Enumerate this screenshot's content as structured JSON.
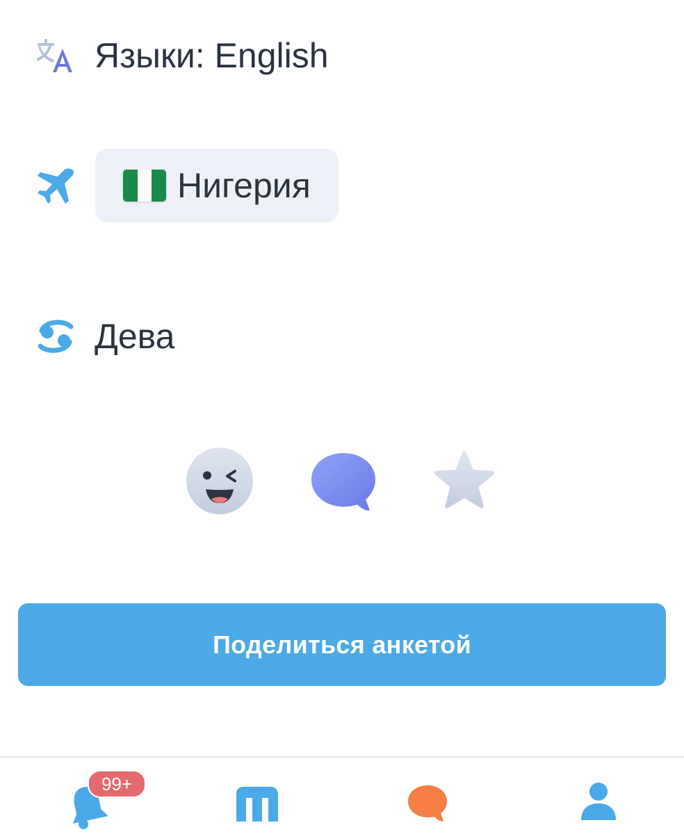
{
  "profile": {
    "languages": "Языки: English",
    "country": "Нигерия",
    "zodiac": "Дева"
  },
  "icons": {
    "languages": "translate-icon",
    "country": "airplane-icon",
    "zodiac": "zodiac-sign-icon",
    "flag": "nigeria-flag-icon"
  },
  "actions": [
    {
      "name": "wink-button",
      "icon": "wink-face-icon"
    },
    {
      "name": "chat-button",
      "icon": "chat-bubble-icon"
    },
    {
      "name": "favorite-button",
      "icon": "star-icon"
    }
  ],
  "share_button": {
    "label": "Поделиться анкетой",
    "color": "#4aa9e6"
  },
  "tabbar": {
    "items": [
      {
        "name": "notifications",
        "icon": "bell-icon",
        "badge": "99+"
      },
      {
        "name": "meet",
        "icon": "m-logo-icon"
      },
      {
        "name": "messages",
        "icon": "chat-bubble-icon"
      },
      {
        "name": "profile",
        "icon": "person-icon"
      }
    ]
  },
  "colors": {
    "accent": "#4aa9e6",
    "badge": "#e46a6e",
    "chat_orange": "#f47e44",
    "chip_background": "#edf0f6"
  }
}
